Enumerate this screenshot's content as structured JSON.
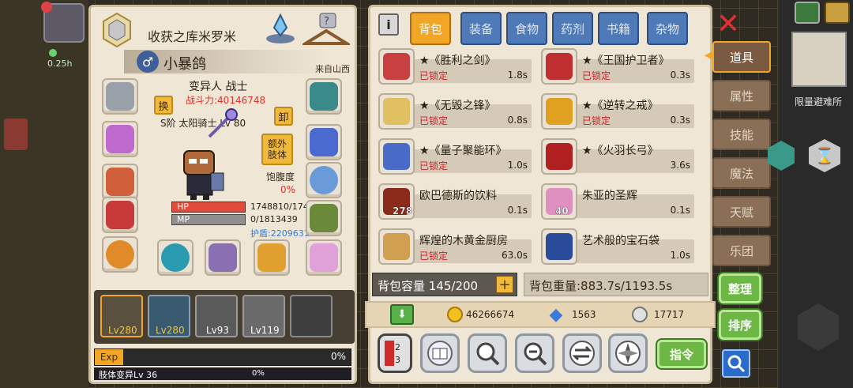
{
  "left_top": {
    "small_count": "0.25h",
    "id_partial": "1748810"
  },
  "character": {
    "title": "收获之库米罗米",
    "gender_icon": "male-icon",
    "name": "小暴鸽",
    "origin": "来自山西",
    "class": "变异人 战士",
    "power": "战斗力:40146748",
    "swap_label": "换",
    "unequip_label": "卸",
    "weapon_info": "S阶 太阳骑士 Lv 80",
    "extra_body_label": "额外肢体",
    "satiety_label": "饱腹度",
    "satiety_value": "0%",
    "hp_label": "HP",
    "hp_value": "1748810/174",
    "mp_label": "MP",
    "mp_value": "0/1813439",
    "shield": "护盾:2209631"
  },
  "team": [
    {
      "level": "Lv280"
    },
    {
      "level": "Lv280"
    },
    {
      "level": "Lv93"
    },
    {
      "level": "Lv119"
    },
    {
      "level": ""
    }
  ],
  "exp": {
    "label": "Exp",
    "value": "0%",
    "progress": 0,
    "mutation_label": "肢体变异Lv 36",
    "mutation_value": "0%",
    "mutation_progress": 0
  },
  "tabs": [
    "背包",
    "装备",
    "食物",
    "药剂",
    "书籍",
    "杂物"
  ],
  "active_tab": "背包",
  "items": [
    {
      "name": "★《胜利之剑》",
      "locked": "已锁定",
      "weight": "1.8s",
      "count": ""
    },
    {
      "name": "★《王国护卫者》",
      "locked": "已锁定",
      "weight": "0.3s",
      "count": ""
    },
    {
      "name": "★《无毁之锋》",
      "locked": "已锁定",
      "weight": "0.8s",
      "count": ""
    },
    {
      "name": "★《逆转之戒》",
      "locked": "已锁定",
      "weight": "0.3s",
      "count": ""
    },
    {
      "name": "★《量子聚能环》",
      "locked": "已锁定",
      "weight": "1.0s",
      "count": ""
    },
    {
      "name": "★《火羽长弓》",
      "locked": "",
      "weight": "3.6s",
      "count": ""
    },
    {
      "name": "欧巴德斯的饮料",
      "locked": "",
      "weight": "0.1s",
      "count": "278"
    },
    {
      "name": "朱亚的圣辉",
      "locked": "",
      "weight": "0.1s",
      "count": "40"
    },
    {
      "name": "辉煌的木黄金厨房",
      "locked": "已锁定",
      "weight": "63.0s",
      "count": ""
    },
    {
      "name": "艺术般的宝石袋",
      "locked": "",
      "weight": "1.0s",
      "count": ""
    }
  ],
  "bag_capacity": "背包容量 145/200",
  "bag_weight": "背包重量:883.7s/1193.5s",
  "currency": {
    "gold": "46266674",
    "diamond": "1563",
    "silver": "17717"
  },
  "side_menu": [
    "道具",
    "属性",
    "技能",
    "魔法",
    "天赋",
    "乐团"
  ],
  "active_side": "道具",
  "buttons": {
    "sort_label": "整理",
    "order_label": "排序",
    "command_label": "指令"
  },
  "top_right": {
    "partial_text": "限量避难所"
  },
  "colors": {
    "accent": "#f2a628",
    "tab_blue": "#4e7ab8",
    "lock_red": "#d0202a",
    "hp_red": "#e24a3a",
    "mp_gray": "#8f8f8f",
    "exp_orange": "#f2a628",
    "panel_bg": "#efe6d6"
  }
}
